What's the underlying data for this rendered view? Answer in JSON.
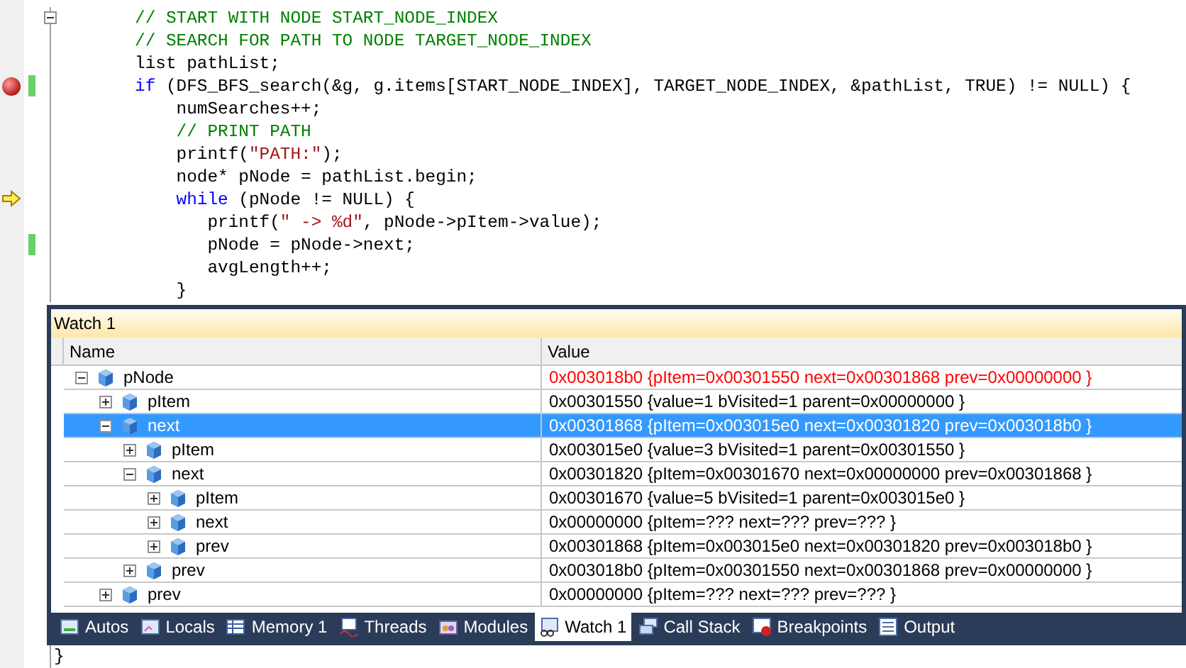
{
  "code": {
    "lines": [
      {
        "breakpoint": false,
        "current": false,
        "changed": false,
        "fold": true,
        "tokens": [
          {
            "kind": "comment",
            "text": "// START WITH NODE START_NODE_INDEX"
          }
        ]
      },
      {
        "breakpoint": false,
        "current": false,
        "changed": false,
        "fold": false,
        "tokens": [
          {
            "kind": "comment",
            "text": "// SEARCH FOR PATH TO NODE TARGET_NODE_INDEX"
          }
        ]
      },
      {
        "breakpoint": false,
        "current": false,
        "changed": false,
        "fold": false,
        "tokens": [
          {
            "kind": "plain",
            "text": "list pathList;"
          }
        ]
      },
      {
        "breakpoint": true,
        "current": false,
        "changed": true,
        "fold": false,
        "tokens": [
          {
            "kind": "keyword",
            "text": "if"
          },
          {
            "kind": "plain",
            "text": " (DFS_BFS_search(&g, g.items[START_NODE_INDEX], TARGET_NODE_INDEX, &pathList, TRUE) != NULL) {"
          }
        ]
      },
      {
        "breakpoint": false,
        "current": false,
        "changed": false,
        "fold": false,
        "tokens": [
          {
            "kind": "plain",
            "text": "    numSearches++;"
          }
        ]
      },
      {
        "breakpoint": false,
        "current": false,
        "changed": false,
        "fold": false,
        "tokens": [
          {
            "kind": "comment",
            "text": "    // PRINT PATH"
          }
        ]
      },
      {
        "breakpoint": false,
        "current": false,
        "changed": false,
        "fold": false,
        "tokens": [
          {
            "kind": "plain",
            "text": "    printf("
          },
          {
            "kind": "string",
            "text": "\"PATH:\""
          },
          {
            "kind": "plain",
            "text": ");"
          }
        ]
      },
      {
        "breakpoint": false,
        "current": false,
        "changed": false,
        "fold": false,
        "tokens": [
          {
            "kind": "plain",
            "text": "    node* pNode = pathList.begin;"
          }
        ]
      },
      {
        "breakpoint": false,
        "current": true,
        "changed": false,
        "fold": false,
        "tokens": [
          {
            "kind": "keyword",
            "text": "    while"
          },
          {
            "kind": "plain",
            "text": " (pNode != NULL) {"
          }
        ]
      },
      {
        "breakpoint": false,
        "current": false,
        "changed": false,
        "fold": false,
        "tokens": [
          {
            "kind": "plain",
            "text": "       printf("
          },
          {
            "kind": "string",
            "text": "\" -> %d\""
          },
          {
            "kind": "plain",
            "text": ", pNode->pItem->value);"
          }
        ]
      },
      {
        "breakpoint": false,
        "current": false,
        "changed": true,
        "fold": false,
        "tokens": [
          {
            "kind": "plain",
            "text": "       pNode = pNode->next;"
          }
        ]
      },
      {
        "breakpoint": false,
        "current": false,
        "changed": false,
        "fold": false,
        "tokens": [
          {
            "kind": "plain",
            "text": "       avgLength++;"
          }
        ]
      },
      {
        "breakpoint": false,
        "current": false,
        "changed": false,
        "fold": false,
        "tokens": [
          {
            "kind": "plain",
            "text": "    }"
          }
        ]
      }
    ],
    "after": "}"
  },
  "watch": {
    "title": "Watch 1",
    "columns": [
      "Name",
      "Value"
    ],
    "rows": [
      {
        "name": "pNode",
        "value": "0x003018b0 {pItem=0x00301550 next=0x00301868 prev=0x00000000 }",
        "changed": true,
        "selected": false,
        "expanded": true,
        "children": [
          {
            "name": "pItem",
            "value": "0x00301550 {value=1 bVisited=1 parent=0x00000000 }",
            "changed": false,
            "selected": false,
            "expanded": false
          },
          {
            "name": "next",
            "value": "0x00301868 {pItem=0x003015e0 next=0x00301820 prev=0x003018b0 }",
            "changed": false,
            "selected": true,
            "expanded": true,
            "children": [
              {
                "name": "pItem",
                "value": "0x003015e0 {value=3 bVisited=1 parent=0x00301550 }",
                "changed": false,
                "selected": false,
                "expanded": false
              },
              {
                "name": "next",
                "value": "0x00301820 {pItem=0x00301670 next=0x00000000 prev=0x00301868 }",
                "changed": false,
                "selected": false,
                "expanded": true,
                "children": [
                  {
                    "name": "pItem",
                    "value": "0x00301670 {value=5 bVisited=1 parent=0x003015e0 }",
                    "changed": false,
                    "selected": false,
                    "expanded": false
                  },
                  {
                    "name": "next",
                    "value": "0x00000000 {pItem=??? next=??? prev=??? }",
                    "changed": false,
                    "selected": false,
                    "expanded": false
                  },
                  {
                    "name": "prev",
                    "value": "0x00301868 {pItem=0x003015e0 next=0x00301820 prev=0x003018b0 }",
                    "changed": false,
                    "selected": false,
                    "expanded": false
                  }
                ]
              },
              {
                "name": "prev",
                "value": "0x003018b0 {pItem=0x00301550 next=0x00301868 prev=0x00000000 }",
                "changed": false,
                "selected": false,
                "expanded": false
              }
            ]
          },
          {
            "name": "prev",
            "value": "0x00000000 {pItem=??? next=??? prev=??? }",
            "changed": false,
            "selected": false,
            "expanded": false
          }
        ]
      }
    ],
    "tabs": [
      {
        "label": "Autos",
        "kind": "autos",
        "selected": false
      },
      {
        "label": "Locals",
        "kind": "locals",
        "selected": false
      },
      {
        "label": "Memory 1",
        "kind": "memory",
        "selected": false
      },
      {
        "label": "Threads",
        "kind": "threads",
        "selected": false
      },
      {
        "label": "Modules",
        "kind": "modules",
        "selected": false
      },
      {
        "label": "Watch 1",
        "kind": "watch",
        "selected": true
      },
      {
        "label": "Call Stack",
        "kind": "callstack",
        "selected": false
      },
      {
        "label": "Breakpoints",
        "kind": "breakpoints",
        "selected": false
      },
      {
        "label": "Output",
        "kind": "output",
        "selected": false
      }
    ]
  }
}
